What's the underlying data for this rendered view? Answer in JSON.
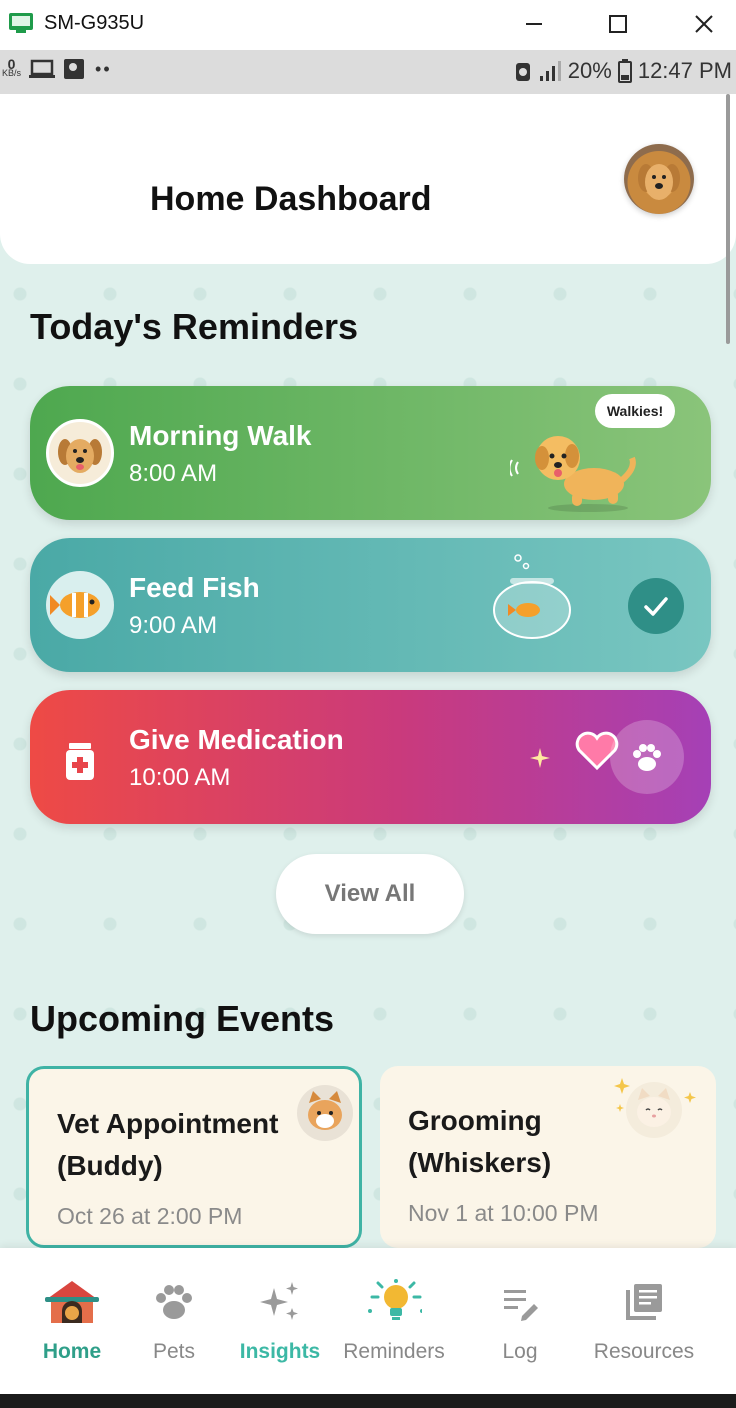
{
  "window": {
    "title": "SM-G935U"
  },
  "statusbar": {
    "kbs_value": "0",
    "kbs_unit": "KB/s",
    "battery": "20%",
    "time": "12:47 PM"
  },
  "header": {
    "title": "Home Dashboard"
  },
  "reminders": {
    "title": "Today's Reminders",
    "items": [
      {
        "name": "Morning Walk",
        "time": "8:00 AM",
        "bubble": "Walkies!"
      },
      {
        "name": "Feed Fish",
        "time": "9:00 AM"
      },
      {
        "name": "Give Medication",
        "time": "10:00 AM"
      }
    ],
    "view_all": "View All"
  },
  "events": {
    "title": "Upcoming Events",
    "items": [
      {
        "name": "Vet Appointment (Buddy)",
        "date": "Oct 26 at 2:00 PM"
      },
      {
        "name": "Grooming (Whiskers)",
        "date": "Nov 1 at 10:00 PM"
      }
    ]
  },
  "nav": {
    "items": [
      {
        "label": "Home",
        "icon": "doghouse-icon",
        "active": true
      },
      {
        "label": "Pets",
        "icon": "paw-icon"
      },
      {
        "label": "Insights",
        "icon": "sparkles-icon"
      },
      {
        "label": "Reminders",
        "icon": "lightbulb-icon"
      },
      {
        "label": "Log",
        "icon": "edit-list-icon"
      },
      {
        "label": "Resources",
        "icon": "library-icon"
      }
    ]
  },
  "colors": {
    "accent": "#3fb3a5",
    "walk": "#4ea84f",
    "fish": "#4aa9a6",
    "medication": "#ee4a45",
    "background": "#dff0ec"
  }
}
